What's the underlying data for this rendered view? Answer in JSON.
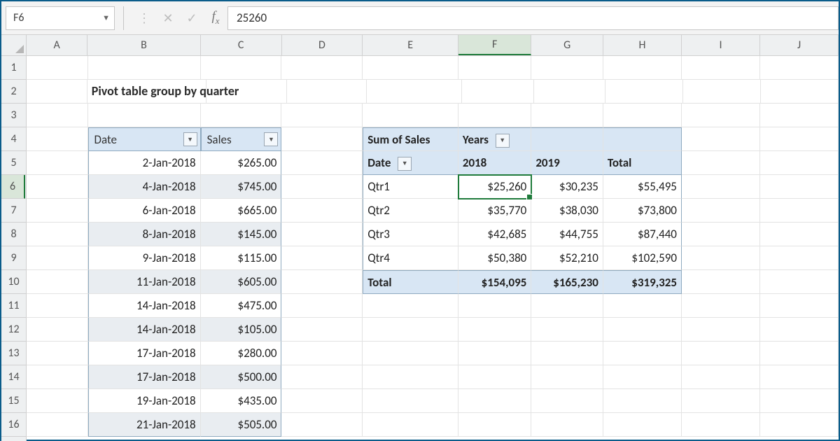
{
  "formula_bar": {
    "cell_ref": "F6",
    "value": "25260"
  },
  "columns": [
    "A",
    "B",
    "C",
    "D",
    "E",
    "F",
    "G",
    "H",
    "I",
    "J"
  ],
  "selected_col": "F",
  "row_labels": [
    "1",
    "2",
    "3",
    "4",
    "5",
    "6",
    "7",
    "8",
    "9",
    "10",
    "11",
    "12",
    "13",
    "14",
    "15",
    "16"
  ],
  "selected_row": "6",
  "title": "Pivot table group by quarter",
  "table": {
    "headers": [
      "Date",
      "Sales"
    ],
    "rows": [
      {
        "date": "2-Jan-2018",
        "sales": "$265.00"
      },
      {
        "date": "4-Jan-2018",
        "sales": "$745.00"
      },
      {
        "date": "6-Jan-2018",
        "sales": "$665.00"
      },
      {
        "date": "8-Jan-2018",
        "sales": "$145.00"
      },
      {
        "date": "9-Jan-2018",
        "sales": "$115.00"
      },
      {
        "date": "11-Jan-2018",
        "sales": "$605.00"
      },
      {
        "date": "14-Jan-2018",
        "sales": "$475.00"
      },
      {
        "date": "14-Jan-2018",
        "sales": "$105.00"
      },
      {
        "date": "17-Jan-2018",
        "sales": "$280.00"
      },
      {
        "date": "17-Jan-2018",
        "sales": "$500.00"
      },
      {
        "date": "19-Jan-2018",
        "sales": "$435.00"
      },
      {
        "date": "21-Jan-2018",
        "sales": "$505.00"
      }
    ]
  },
  "pivot": {
    "measure": "Sum of Sales",
    "col_field": "Years",
    "row_field": "Date",
    "cols": [
      "2018",
      "2019",
      "Total"
    ],
    "rows": [
      {
        "label": "Qtr1",
        "vals": [
          "$25,260",
          "$30,235",
          "$55,495"
        ]
      },
      {
        "label": "Qtr2",
        "vals": [
          "$35,770",
          "$38,030",
          "$73,800"
        ]
      },
      {
        "label": "Qtr3",
        "vals": [
          "$42,685",
          "$44,755",
          "$87,440"
        ]
      },
      {
        "label": "Qtr4",
        "vals": [
          "$50,380",
          "$52,210",
          "$102,590"
        ]
      }
    ],
    "total": {
      "label": "Total",
      "vals": [
        "$154,095",
        "$165,230",
        "$319,325"
      ]
    }
  }
}
